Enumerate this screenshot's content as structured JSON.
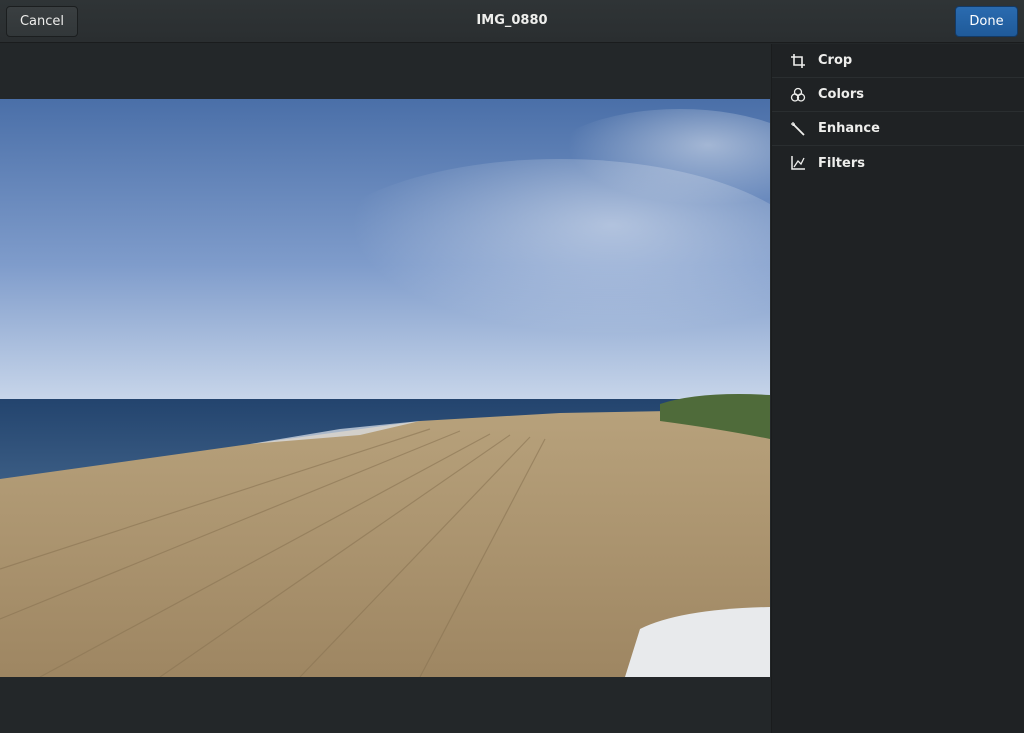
{
  "header": {
    "cancel_label": "Cancel",
    "title": "IMG_0880",
    "done_label": "Done"
  },
  "sidebar": {
    "tools": [
      {
        "label": "Crop",
        "icon": "crop-icon"
      },
      {
        "label": "Colors",
        "icon": "colors-icon"
      },
      {
        "label": "Enhance",
        "icon": "enhance-icon"
      },
      {
        "label": "Filters",
        "icon": "filters-icon"
      }
    ]
  },
  "colors": {
    "accent": "#215d9c",
    "header_bg": "#2d3234",
    "sidebar_bg": "#1f2224"
  }
}
